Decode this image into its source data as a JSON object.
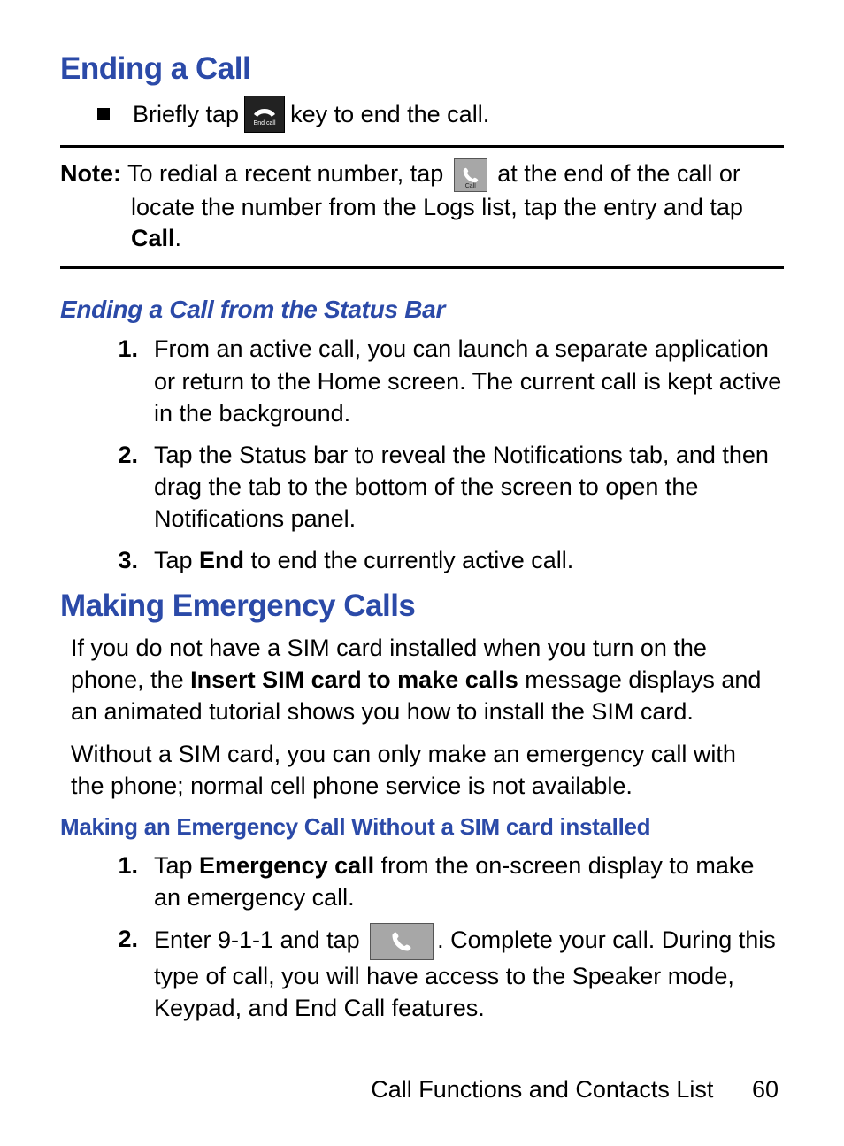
{
  "heading1": "Ending a Call",
  "bullet1_pre": "Briefly tap ",
  "bullet1_post": " key to end the call.",
  "endcall_icon_label": "End call",
  "note_label": "Note:",
  "note_line1_pre": " To redial a recent number, tap ",
  "note_line1_post": " at the end of the call or",
  "call_icon_small_label": "Call",
  "note_line2_a": "locate the number from the Logs list, tap the entry and tap ",
  "note_line2_b": "Call",
  "note_line2_c": ".",
  "heading2": "Ending a Call from the Status Bar",
  "steps_a": [
    {
      "n": "1.",
      "t": "From an active call, you can launch a separate application or return to the Home screen. The current call is kept active in the background."
    },
    {
      "n": "2.",
      "t": "Tap the Status bar to reveal the Notifications tab, and then drag the tab to the bottom of the screen to open the Notifications panel."
    }
  ],
  "step_a3_n": "3.",
  "step_a3_pre": "Tap ",
  "step_a3_b": "End",
  "step_a3_post": " to end the currently active call.",
  "heading3": "Making Emergency Calls",
  "para1_a": "If you do not have a SIM card installed when you turn on the phone, the ",
  "para1_b": "Insert SIM card to make calls",
  "para1_c": " message displays and an animated tutorial shows you how to install the SIM card.",
  "para2": "Without a SIM card, you can only make an emergency call with the phone; normal cell phone service is not available.",
  "heading4": "Making an Emergency Call Without a SIM card installed",
  "step_b1_n": "1.",
  "step_b1_pre": "Tap ",
  "step_b1_b": "Emergency call",
  "step_b1_post": " from the on-screen display to make an emergency call.",
  "step_b2_n": "2.",
  "step_b2_pre": "Enter 9-1-1 and tap ",
  "step_b2_post": ". Complete your call. During this type of call, you will have access to the Speaker mode, Keypad, and End Call features.",
  "footer_section": "Call Functions and Contacts List",
  "footer_page": "60"
}
